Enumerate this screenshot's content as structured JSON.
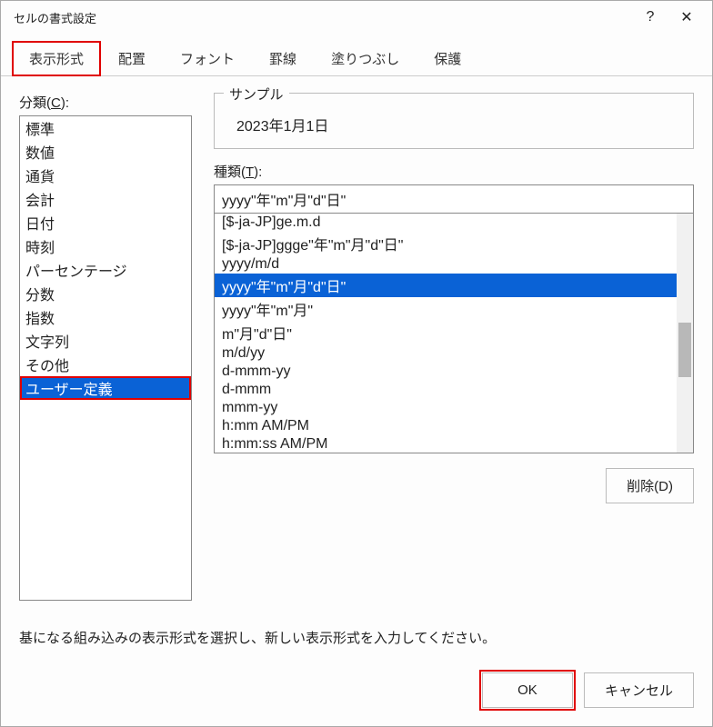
{
  "titlebar": {
    "title": "セルの書式設定",
    "help": "?",
    "close": "✕"
  },
  "tabs": [
    {
      "label": "表示形式",
      "active": true,
      "highlighted": true
    },
    {
      "label": "配置"
    },
    {
      "label": "フォント"
    },
    {
      "label": "罫線"
    },
    {
      "label": "塗りつぶし"
    },
    {
      "label": "保護"
    }
  ],
  "category": {
    "label_prefix": "分類(",
    "label_ul": "C",
    "label_suffix": "):",
    "items": [
      {
        "label": "標準"
      },
      {
        "label": "数値"
      },
      {
        "label": "通貨"
      },
      {
        "label": "会計"
      },
      {
        "label": "日付"
      },
      {
        "label": "時刻"
      },
      {
        "label": "パーセンテージ"
      },
      {
        "label": "分数"
      },
      {
        "label": "指数"
      },
      {
        "label": "文字列"
      },
      {
        "label": "その他"
      },
      {
        "label": "ユーザー定義",
        "selected": true,
        "highlighted": true
      }
    ]
  },
  "sample": {
    "legend": "サンプル",
    "value": "2023年1月1日"
  },
  "type": {
    "label_prefix": "種類(",
    "label_ul": "T",
    "label_suffix": "):",
    "input_value": "yyyy\"年\"m\"月\"d\"日\"",
    "items": [
      {
        "label": "[$-ja-JP]ge.m.d"
      },
      {
        "label": "[$-ja-JP]ggge\"年\"m\"月\"d\"日\""
      },
      {
        "label": "yyyy/m/d"
      },
      {
        "label": "yyyy\"年\"m\"月\"d\"日\"",
        "selected": true
      },
      {
        "label": "yyyy\"年\"m\"月\""
      },
      {
        "label": "m\"月\"d\"日\""
      },
      {
        "label": "m/d/yy"
      },
      {
        "label": "d-mmm-yy"
      },
      {
        "label": "d-mmm"
      },
      {
        "label": "mmm-yy"
      },
      {
        "label": "h:mm AM/PM"
      },
      {
        "label": "h:mm:ss AM/PM"
      }
    ]
  },
  "delete_button": "削除(D)",
  "hint": "基になる組み込みの表示形式を選択し、新しい表示形式を入力してください。",
  "footer": {
    "ok": "OK",
    "cancel": "キャンセル"
  }
}
